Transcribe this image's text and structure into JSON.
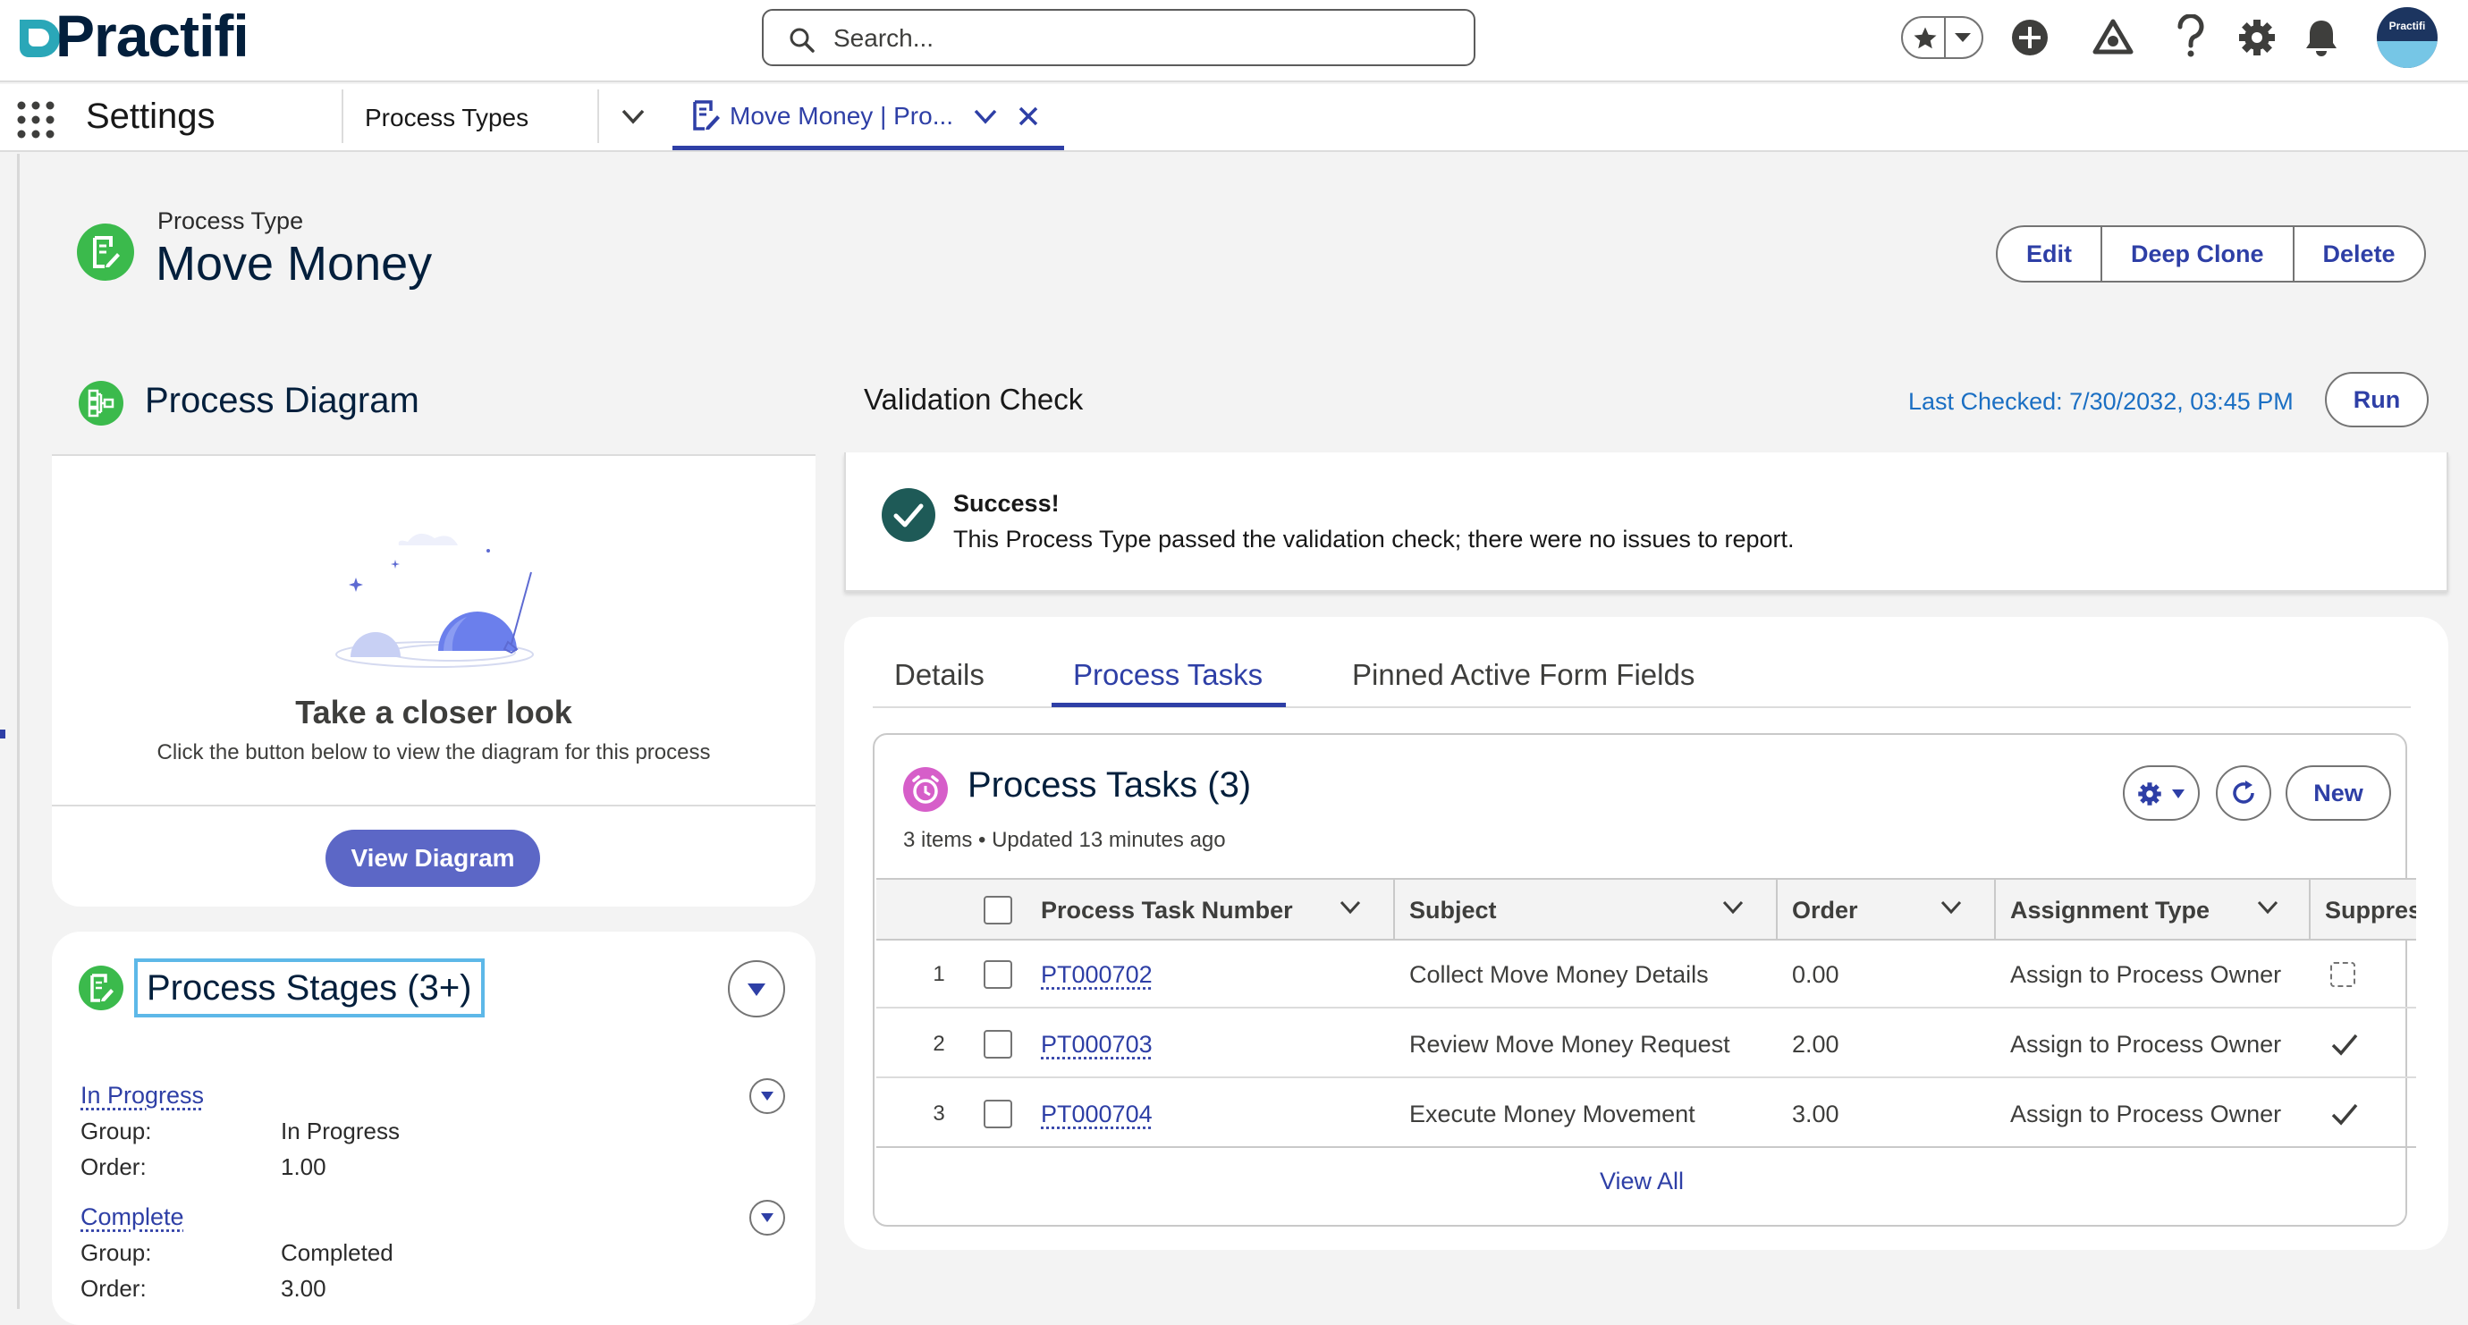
{
  "header": {
    "logo_text": "Practifi",
    "search_placeholder": "Search...",
    "avatar_text": "Practifi"
  },
  "nav": {
    "app_name": "Settings",
    "items": [
      {
        "label": "Process Types"
      },
      {
        "label": "Move Money | Pro..."
      }
    ]
  },
  "record": {
    "object_type": "Process Type",
    "title": "Move Money",
    "actions": [
      "Edit",
      "Deep Clone",
      "Delete"
    ]
  },
  "diagram": {
    "title": "Process Diagram",
    "headline": "Take a closer look",
    "subtext": "Click the button below to view the diagram for this process",
    "button": "View Diagram"
  },
  "stages": {
    "title": "Process Stages (3+)",
    "group_label": "Group:",
    "order_label": "Order:",
    "items": [
      {
        "name": "In Progress",
        "group": "In Progress",
        "order": "1.00"
      },
      {
        "name": "Complete",
        "group": "Completed",
        "order": "3.00"
      }
    ]
  },
  "validation": {
    "title": "Validation Check",
    "last_checked": "Last Checked: 7/30/2032, 03:45 PM",
    "run_label": "Run",
    "status": "Success!",
    "message": "This Process Type passed the validation check; there were no issues to report."
  },
  "tabs": [
    {
      "label": "Details",
      "active": false
    },
    {
      "label": "Process Tasks",
      "active": true
    },
    {
      "label": "Pinned Active Form Fields",
      "active": false
    }
  ],
  "tasks": {
    "title": "Process Tasks (3)",
    "meta": "3 items • Updated 13 minutes ago",
    "new_label": "New",
    "columns": [
      "Process Task Number",
      "Subject",
      "Order",
      "Assignment Type",
      "Suppres"
    ],
    "rows": [
      {
        "num": "1",
        "task": "PT000702",
        "subject": "Collect Move Money Details",
        "order": "0.00",
        "assignment": "Assign to Process Owner",
        "suppressed": false
      },
      {
        "num": "2",
        "task": "PT000703",
        "subject": "Review Move Money Request",
        "order": "2.00",
        "assignment": "Assign to Process Owner",
        "suppressed": true
      },
      {
        "num": "3",
        "task": "PT000704",
        "subject": "Execute Money Movement",
        "order": "3.00",
        "assignment": "Assign to Process Owner",
        "suppressed": true
      }
    ],
    "view_all": "View All"
  },
  "colors": {
    "brand_navy": "#031f3c",
    "link_blue": "#2e3fa6",
    "record_icon_green": "#3bba4c",
    "tasks_icon_pink": "#d65ec9",
    "primary_button": "#5c67c6",
    "success_teal": "#1e5a57"
  }
}
